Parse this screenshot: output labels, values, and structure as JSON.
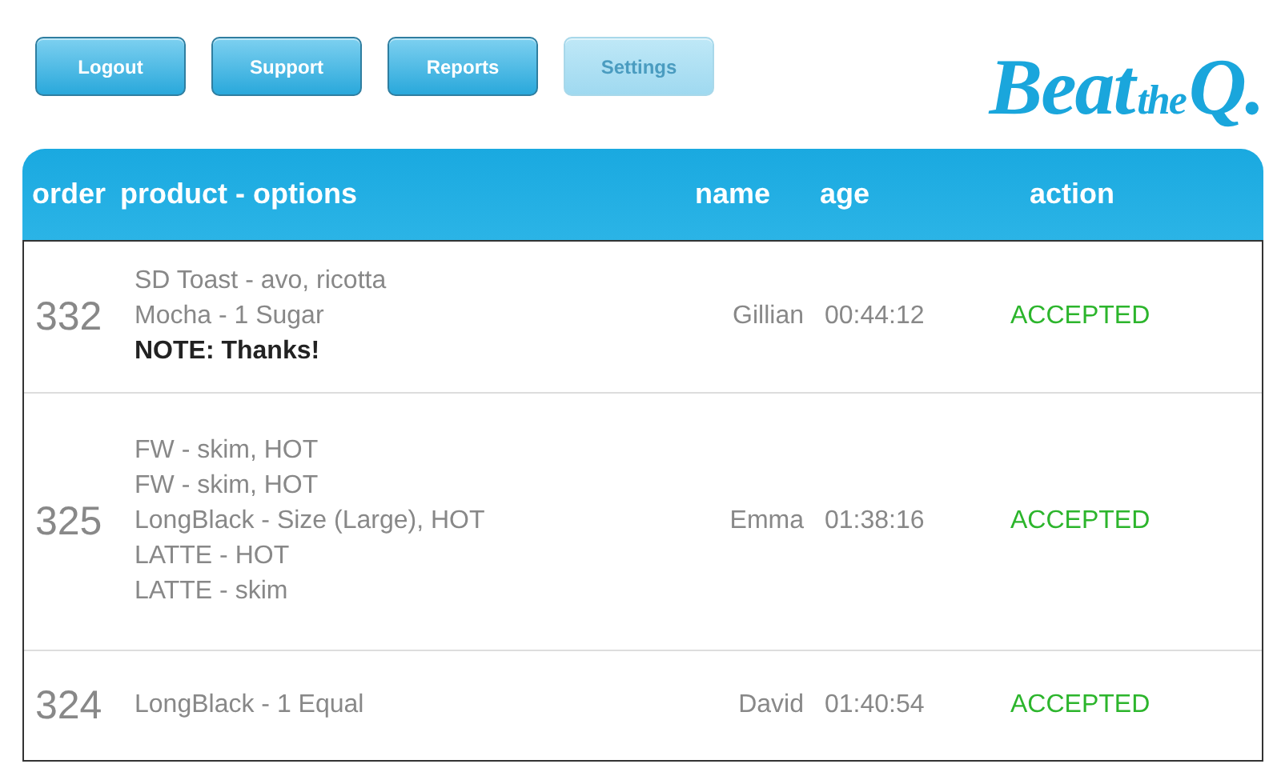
{
  "toolbar": {
    "buttons": [
      {
        "label": "Logout",
        "disabled": false
      },
      {
        "label": "Support",
        "disabled": false
      },
      {
        "label": "Reports",
        "disabled": false
      },
      {
        "label": "Settings",
        "disabled": true
      }
    ]
  },
  "logo": {
    "word": "Beat",
    "small": "the",
    "end": "Q."
  },
  "table": {
    "columns": [
      "order",
      "product - options",
      "name",
      "age",
      "action"
    ],
    "rows": [
      {
        "order": "332",
        "lines": [
          {
            "kind": "item",
            "text": "SD Toast - avo, ricotta"
          },
          {
            "kind": "item",
            "text": "Mocha - 1 Sugar"
          },
          {
            "kind": "note",
            "text": "NOTE: Thanks!"
          }
        ],
        "name": "Gillian",
        "age": "00:44:12",
        "action": "ACCEPTED"
      },
      {
        "order": "325",
        "lines": [
          {
            "kind": "item",
            "text": "FW - skim, HOT"
          },
          {
            "kind": "item",
            "text": "FW - skim, HOT"
          },
          {
            "kind": "item",
            "text": "LongBlack - Size (Large), HOT"
          },
          {
            "kind": "item",
            "text": "LATTE - HOT"
          },
          {
            "kind": "item",
            "text": "LATTE - skim"
          }
        ],
        "name": "Emma",
        "age": "01:38:16",
        "action": "ACCEPTED"
      },
      {
        "order": "324",
        "lines": [
          {
            "kind": "item",
            "text": "LongBlack - 1 Equal"
          }
        ],
        "name": "David",
        "age": "01:40:54",
        "action": "ACCEPTED"
      }
    ]
  }
}
